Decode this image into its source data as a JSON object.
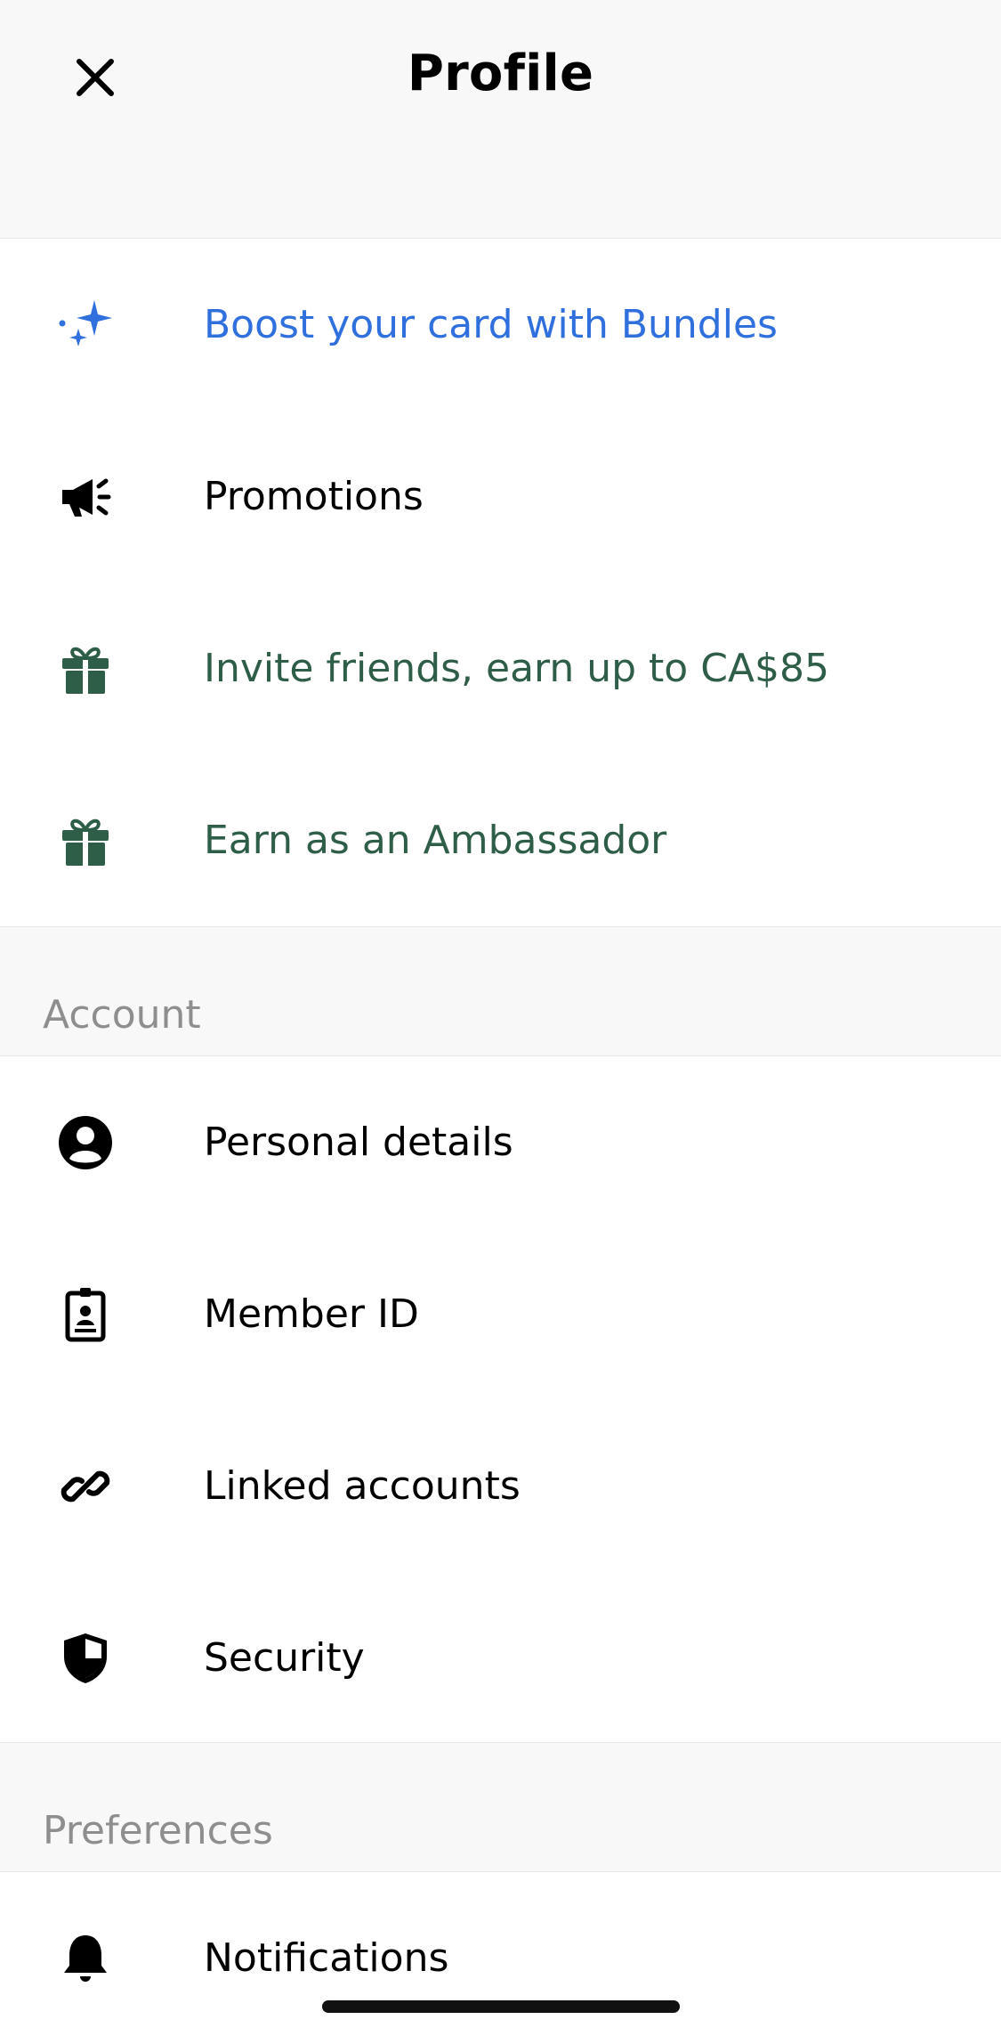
{
  "header": {
    "title": "Profile",
    "close_icon": "close-icon"
  },
  "colors": {
    "accent_blue": "#2f6fde",
    "accent_green": "#2e5e48",
    "section_label": "#8e8e8e",
    "background_gray": "#f8f8f8"
  },
  "promos": {
    "items": [
      {
        "label": "Boost your card with Bundles",
        "icon": "sparkles-icon"
      },
      {
        "label": "Promotions",
        "icon": "megaphone-icon"
      },
      {
        "label": "Invite friends, earn up to CA$85",
        "icon": "gift-icon"
      },
      {
        "label": "Earn as an Ambassador",
        "icon": "gift-icon"
      }
    ]
  },
  "account": {
    "section_label": "Account",
    "items": [
      {
        "label": "Personal details",
        "icon": "user-circle-icon"
      },
      {
        "label": "Member ID",
        "icon": "id-badge-icon"
      },
      {
        "label": "Linked accounts",
        "icon": "link-icon"
      },
      {
        "label": "Security",
        "icon": "shield-icon"
      }
    ]
  },
  "preferences": {
    "section_label": "Preferences",
    "items": [
      {
        "label": "Notifications",
        "icon": "bell-icon"
      }
    ]
  }
}
